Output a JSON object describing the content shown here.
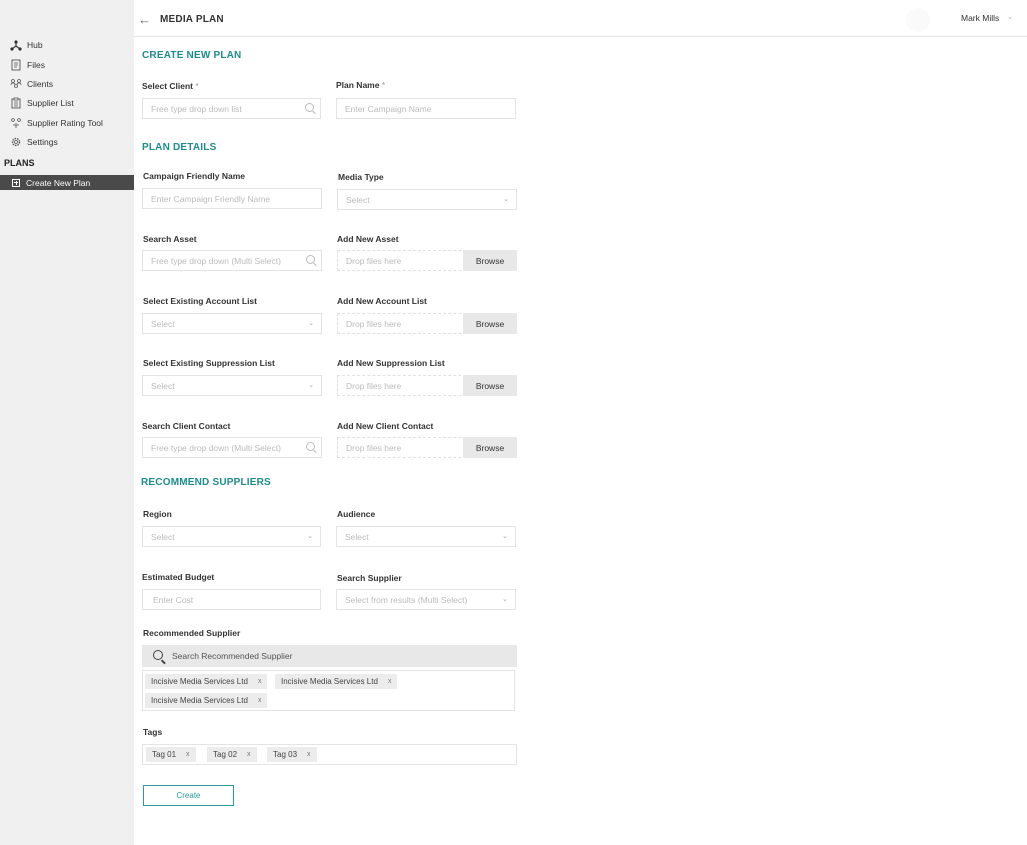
{
  "header": {
    "title": "MEDIA PLAN",
    "user_name": "Mark Mills"
  },
  "sidebar": {
    "items": [
      {
        "label": "Hub",
        "icon": "hub-icon"
      },
      {
        "label": "Files",
        "icon": "file-icon"
      },
      {
        "label": "Clients",
        "icon": "clients-icon"
      },
      {
        "label": "Supplier List",
        "icon": "clipboard-icon"
      },
      {
        "label": "Supplier Rating Tool",
        "icon": "rating-icon"
      },
      {
        "label": "Settings",
        "icon": "gear-icon"
      }
    ],
    "section_heading": "PLANS",
    "active_item": "Create New Plan"
  },
  "create_plan": {
    "title": "CREATE NEW PLAN",
    "client_label": "Select Client",
    "client_placeholder": "Free type drop down list",
    "plan_name_label": "Plan Name",
    "plan_name_placeholder": "Enter Campaign Name",
    "required_mark": "*"
  },
  "plan_details": {
    "title": "PLAN DETAILS",
    "campaign_label": "Campaign Friendly Name",
    "campaign_placeholder": "Enter Campaign Friendly Name",
    "media_type_label": "Media Type",
    "media_type_value": "Select",
    "search_asset_label": "Search Asset",
    "search_asset_placeholder": "Free type drop down (Multi Select)",
    "add_asset_label": "Add New Asset",
    "account_list_label": "Select Existing Account List",
    "account_list_value": "Select",
    "add_account_label": "Add New Account List",
    "suppression_label": "Select Existing Suppression List",
    "suppression_value": "Select",
    "add_suppression_label": "Add New Suppression List",
    "client_contact_label": "Search Client Contact",
    "client_contact_placeholder": "Free type drop down (Multi Select)",
    "add_contact_label": "Add New Client Contact",
    "drop_placeholder": "Drop files here",
    "browse_label": "Browse"
  },
  "suppliers": {
    "title": "RECOMMEND SUPPLIERS",
    "region_label": "Region",
    "region_value": "Select",
    "audience_label": "Audience",
    "audience_value": "Select",
    "budget_label": "Estimated Budget",
    "budget_placeholder": "Enter Cost",
    "search_supplier_label": "Search Supplier",
    "search_supplier_value": "Select from results (Multi Select)",
    "recommended_label": "Recommended Supplier",
    "recommended_search_placeholder": "Search Recommended Supplier",
    "recommended_chips": [
      "Incisive Media Services Ltd",
      "Incisive Media Services Ltd",
      "Incisive Media Services Ltd"
    ],
    "chip_remove": "x"
  },
  "tags": {
    "label": "Tags",
    "items": [
      "Tag 01",
      "Tag 02",
      "Tag 03"
    ]
  },
  "actions": {
    "create_label": "Create"
  }
}
